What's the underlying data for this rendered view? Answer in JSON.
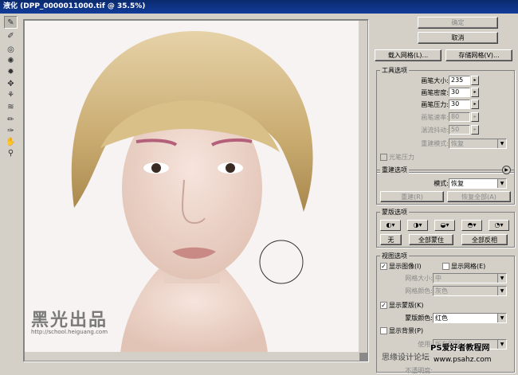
{
  "window": {
    "title": "液化 (DPP_0000011000.tif @ 35.5%)"
  },
  "tools": [
    "warp-tool",
    "reconstruct-tool",
    "twirl-cw-tool",
    "pucker-tool",
    "bloat-tool",
    "push-left-tool",
    "mirror-tool",
    "turbulence-tool",
    "freeze-mask-tool",
    "thaw-mask-tool",
    "hand-tool",
    "zoom-tool"
  ],
  "buttons": {
    "ok": "确定",
    "cancel": "取消",
    "load_mesh": "载入网格(L)...",
    "save_mesh": "存储网格(V)..."
  },
  "tool_options": {
    "title": "工具选项",
    "brush_size_label": "画笔大小:",
    "brush_size": "235",
    "brush_density_label": "画笔密度:",
    "brush_density": "30",
    "brush_pressure_label": "画笔压力:",
    "brush_pressure": "30",
    "brush_rate_label": "画笔速率:",
    "brush_rate": "80",
    "turbulent_jitter_label": "湍流抖动:",
    "turbulent_jitter": "50",
    "reconstruct_mode_label": "重建模式:",
    "reconstruct_mode": "恢复",
    "stylus_pressure_label": "光笔压力"
  },
  "reconstruct_options": {
    "title": "重建选项",
    "mode_label": "模式:",
    "mode": "恢复",
    "reconstruct": "重建(R)",
    "restore_all": "恢复全部(A)"
  },
  "mask_options": {
    "title": "蒙版选项",
    "none": "无",
    "mask_all": "全部蒙住",
    "invert_all": "全部反相"
  },
  "view_options": {
    "title": "视图选项",
    "show_image": "显示图像(I)",
    "show_mesh": "显示网格(E)",
    "mesh_size_label": "网格大小:",
    "mesh_size": "中",
    "mesh_color_label": "网格颜色:",
    "mesh_color": "灰色",
    "show_mask": "显示蒙版(K)",
    "mask_color_label": "蒙版颜色:",
    "mask_color": "红色",
    "show_backdrop": "显示背景(P)",
    "use_label": "使用:",
    "use": "所有图层",
    "opacity_label": "不透明度:"
  },
  "watermarks": {
    "brand": "黑光出品",
    "brand_url": "http://school.heiguang.com",
    "site_left": "思缘设计论坛",
    "site_title": "PS爱好者教程网",
    "site_url": "www.psahz.com"
  }
}
